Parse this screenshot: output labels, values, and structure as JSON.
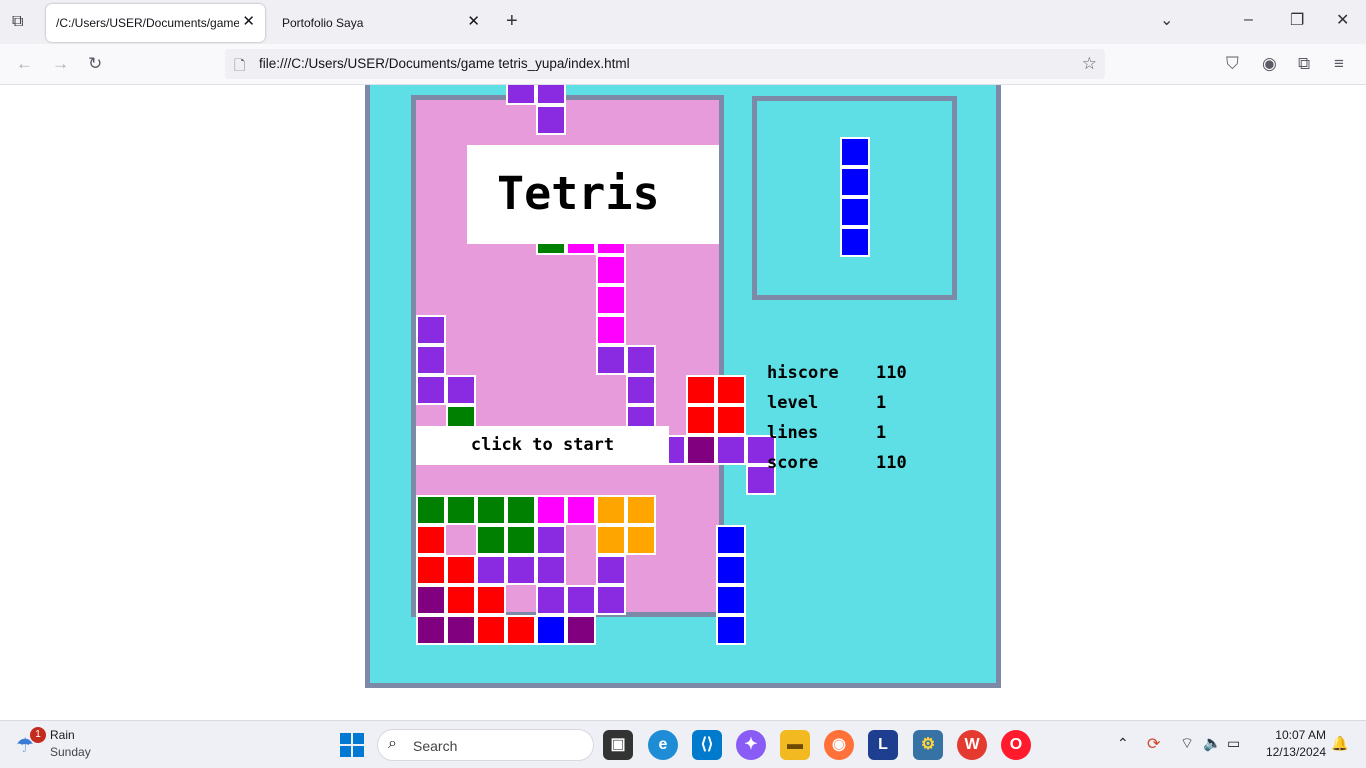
{
  "browser": {
    "tabs": [
      {
        "title": "/C:/Users/USER/Documents/game tetris_yupa/index.html",
        "active": true
      },
      {
        "title": "Portofolio Saya",
        "active": false
      }
    ],
    "url": "file:///C:/Users/USER/Documents/game tetris_yupa/index.html"
  },
  "game": {
    "title": "Tetris",
    "start_label": "click to start",
    "stats": [
      {
        "label": "hiscore",
        "value": "110"
      },
      {
        "label": "level",
        "value": "1"
      },
      {
        "label": "lines",
        "value": "1"
      },
      {
        "label": "score",
        "value": "110"
      }
    ],
    "colors": {
      "purple": "#8a2be2",
      "magenta": "#ff00ff",
      "red": "#ff0000",
      "green": "#008000",
      "dark_purple": "#800080",
      "orange": "#ffa500",
      "blue": "#0000ff"
    },
    "board_rows": [
      "...PP.....",
      "....P.....",
      "..........",
      "..........",
      "..........",
      "....GMM...",
      "......M...",
      "......M...",
      "P.....M...",
      "P.....PP..",
      "PP.....P.RR",
      ".G.....P.RR.",
      "GGD....PPDPP",
      "...........P",
      "GGGGMMOO....",
      "R.GGP.OO..B.",
      "RRPPP.P...B.",
      "DRR.PPP...B.",
      "DDRRBD....B."
    ],
    "next_piece": {
      "name": "I",
      "color": "#0000ff",
      "orientation": "vertical"
    }
  },
  "taskbar": {
    "weather": {
      "condition": "Rain",
      "day": "Sunday",
      "badge": "1"
    },
    "search_placeholder": "Search",
    "clock": {
      "time": "10:07 AM",
      "date": "12/13/2024"
    }
  }
}
